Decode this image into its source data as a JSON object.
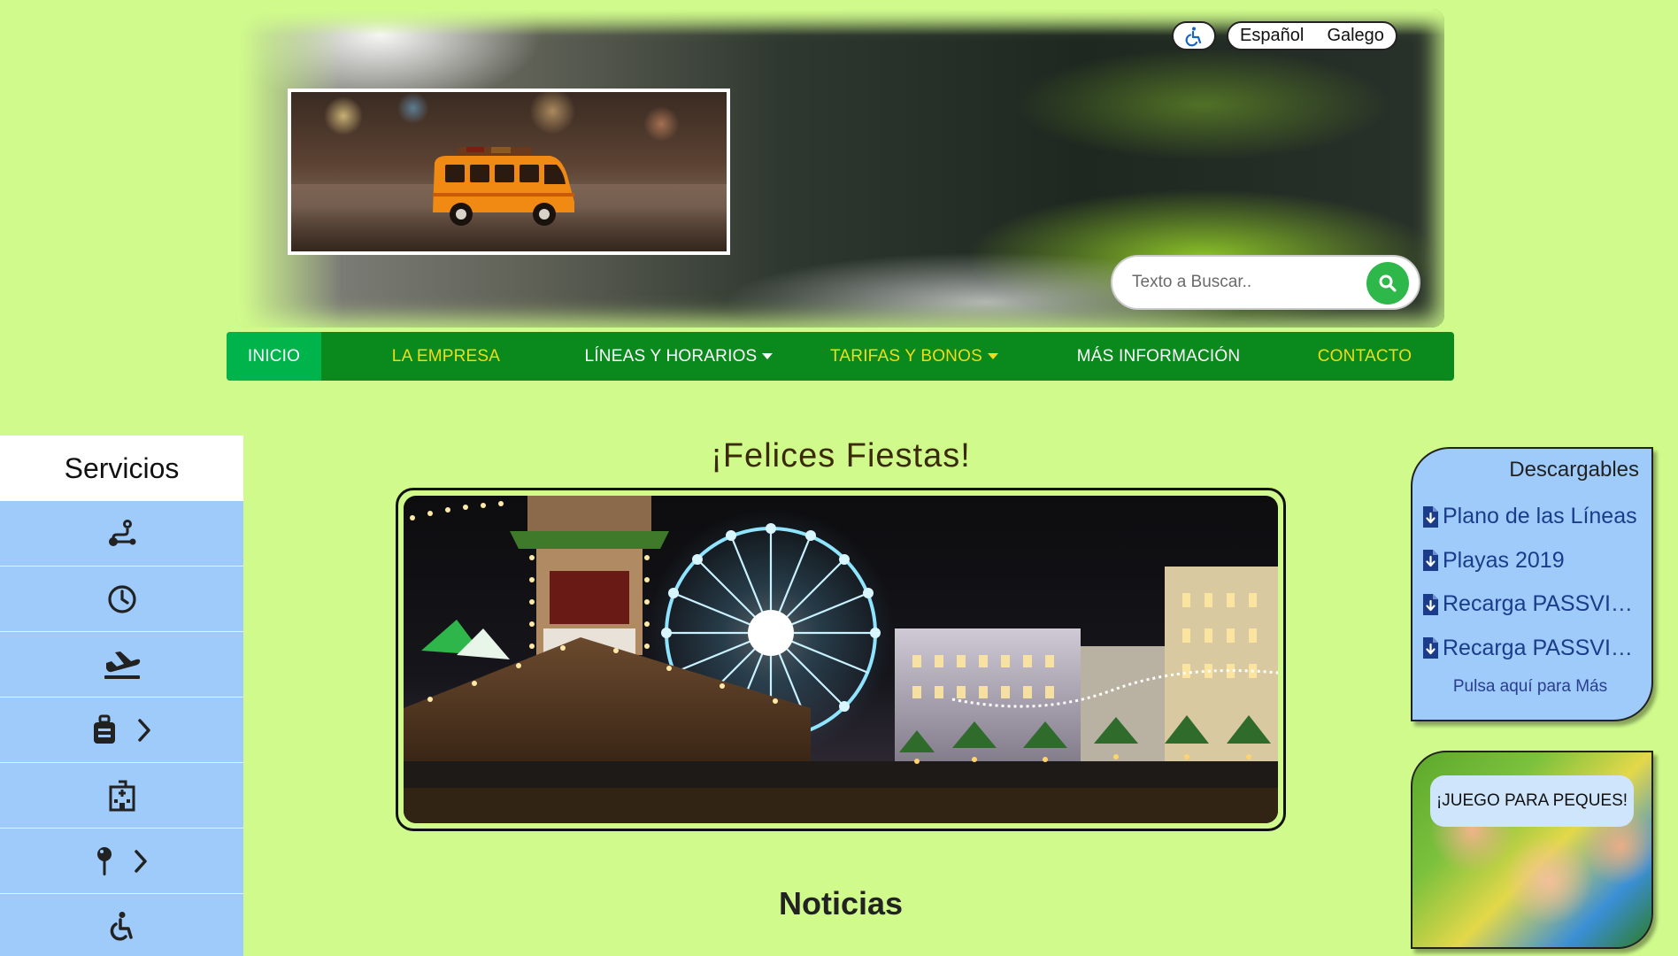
{
  "header": {
    "accessibility_icon": "wheelchair-icon",
    "languages": [
      "Español",
      "Galego"
    ],
    "search_placeholder": "Texto a Buscar..",
    "search_icon": "search-icon"
  },
  "nav": {
    "items": [
      {
        "label": "INICIO",
        "active": true
      },
      {
        "label": "LA EMPRESA"
      },
      {
        "label": "LÍNEAS Y HORARIOS",
        "dropdown": true
      },
      {
        "label": "TARIFAS Y BONOS",
        "dropdown": true
      },
      {
        "label": "MÁS INFORMACIÓN"
      },
      {
        "label": "CONTACTO"
      }
    ],
    "colors": {
      "bar": "#0a8a1c",
      "active": "#00b44c",
      "yellow": "#f2dc1a"
    }
  },
  "sidebar": {
    "title": "Servicios",
    "items": [
      {
        "icon": "route-icon"
      },
      {
        "icon": "clock-icon"
      },
      {
        "icon": "airplane-icon"
      },
      {
        "icon": "luggage-icon",
        "has_submenu": true
      },
      {
        "icon": "hospital-icon"
      },
      {
        "icon": "pin-icon",
        "has_submenu": true
      },
      {
        "icon": "wheelchair-icon"
      }
    ]
  },
  "main": {
    "title": "¡Felices Fiestas!",
    "news_title": "Noticias"
  },
  "downloads": {
    "title": "Descargables",
    "items": [
      "Plano de las Líneas",
      "Playas 2019",
      "Recarga PASSVIGO",
      "Recarga PASSVIGO"
    ],
    "more": "Pulsa aquí para Más"
  },
  "kids_banner": {
    "label": "¡JUEGO PARA PEQUES!"
  },
  "colors": {
    "page_bg": "#d0fb8c",
    "sidebar_item_bg": "#9ecbfa",
    "search_button": "#2eb84a"
  }
}
